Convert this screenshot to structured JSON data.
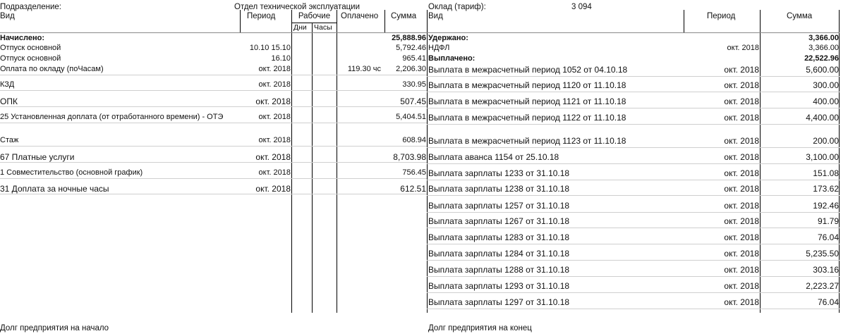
{
  "header": {
    "division_label": "Подразделение:",
    "division_value": "Отдел технической эксплуатации",
    "salary_label": "Оклад (тариф):",
    "salary_value": "3 094"
  },
  "columns_left": {
    "type": "Вид",
    "period": "Период",
    "worked": "Рабочие",
    "days": "Дни",
    "hours": "Часы",
    "paid": "Оплачено",
    "sum": "Сумма"
  },
  "columns_right": {
    "type": "Вид",
    "period": "Период",
    "sum": "Сумма"
  },
  "left": {
    "total_label": "Начислено:",
    "total_sum": "25,888.96",
    "rows": [
      {
        "type": "Отпуск основной",
        "period": "10.10 15.10",
        "paid": "",
        "sum": "5,792.46"
      },
      {
        "type": "Отпуск основной",
        "period": "16.10",
        "paid": "",
        "sum": "965.41"
      },
      {
        "type": "Оплата по окладу (поЧасам)",
        "period": "окт. 2018",
        "paid": "119.30 чс",
        "sum": "2,206.30"
      },
      {
        "type": "КЗД",
        "period": "окт. 2018",
        "paid": "",
        "sum": "330.95"
      },
      {
        "type": "ОПК",
        "period": "окт. 2018",
        "paid": "",
        "sum": "507.45"
      },
      {
        "type": "25 Установленная доплата (от отработанного времени) - ОТЭ",
        "period": "окт. 2018",
        "paid": "",
        "sum": "5,404.51"
      },
      {
        "type": "Стаж",
        "period": "окт. 2018",
        "paid": "",
        "sum": "608.94"
      },
      {
        "type": "67 Платные услуги",
        "period": "окт. 2018",
        "paid": "",
        "sum": "8,703.98"
      },
      {
        "type": "1 Совместительство (основной график)",
        "period": "окт. 2018",
        "paid": "",
        "sum": "756.45"
      },
      {
        "type": "31 Доплата за ночные часы",
        "period": "окт. 2018",
        "paid": "",
        "sum": "612.51"
      }
    ]
  },
  "right": {
    "withheld_label": "Удержано:",
    "withheld_sum": "3,366.00",
    "ndfl_label": "НДФЛ",
    "ndfl_period": "окт. 2018",
    "ndfl_sum": "3,366.00",
    "paid_label": "Выплачено:",
    "paid_sum": "22,522.96",
    "rows": [
      {
        "type": "Выплата в межрасчетный период 1052 от 04.10.18",
        "period": "окт. 2018",
        "sum": "5,600.00"
      },
      {
        "type": "Выплата в межрасчетный период 1120 от 11.10.18",
        "period": "окт. 2018",
        "sum": "300.00"
      },
      {
        "type": "Выплата в межрасчетный период 1121 от 11.10.18",
        "period": "окт. 2018",
        "sum": "400.00"
      },
      {
        "type": "Выплата в межрасчетный период 1122 от 11.10.18",
        "period": "окт. 2018",
        "sum": "4,400.00"
      },
      {
        "type": "Выплата в межрасчетный период 1123 от 11.10.18",
        "period": "окт. 2018",
        "sum": "200.00"
      },
      {
        "type": "Выплата аванса 1154 от 25.10.18",
        "period": "окт. 2018",
        "sum": "3,100.00"
      },
      {
        "type": "Выплата зарплаты 1233 от 31.10.18",
        "period": "окт. 2018",
        "sum": "151.08"
      },
      {
        "type": "Выплата зарплаты 1238 от 31.10.18",
        "period": "окт. 2018",
        "sum": "173.62"
      },
      {
        "type": "Выплата зарплаты 1257 от 31.10.18",
        "period": "окт. 2018",
        "sum": "192.46"
      },
      {
        "type": "Выплата зарплаты 1267 от 31.10.18",
        "period": "окт. 2018",
        "sum": "91.79"
      },
      {
        "type": "Выплата зарплаты 1283 от 31.10.18",
        "period": "окт. 2018",
        "sum": "76.04"
      },
      {
        "type": "Выплата зарплаты 1284 от 31.10.18",
        "period": "окт. 2018",
        "sum": "5,235.50"
      },
      {
        "type": "Выплата зарплаты 1288 от 31.10.18",
        "period": "окт. 2018",
        "sum": "303.16"
      },
      {
        "type": "Выплата зарплаты 1293 от 31.10.18",
        "period": "окт. 2018",
        "sum": "2,223.27"
      },
      {
        "type": "Выплата зарплаты 1297 от 31.10.18",
        "period": "окт. 2018",
        "sum": "76.04"
      }
    ]
  },
  "footer": {
    "debt_start": "Долг предприятия на начало",
    "debt_end": "Долг предприятия на конец"
  }
}
